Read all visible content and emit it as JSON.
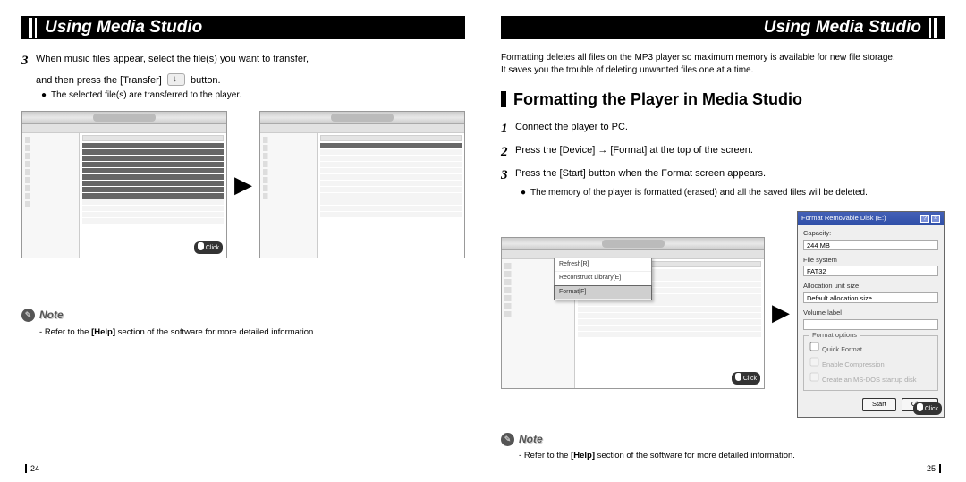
{
  "header": {
    "title": "Using Media Studio"
  },
  "left": {
    "step3": {
      "num": "3",
      "line1": "When music files appear, select the file(s) you want to transfer,",
      "line2_a": "and then press the [Transfer]",
      "line2_b": "button."
    },
    "bullet": "The selected file(s) are transferred to the player.",
    "click_label": "Click",
    "note": {
      "icon_glyph": "✎",
      "label": "Note",
      "text_a": "Refer to the ",
      "text_help": "[Help]",
      "text_b": " section of the software for more detailed information."
    },
    "page_number": "24"
  },
  "right": {
    "intro_line1": "Formatting deletes all files on the MP3 player so maximum memory is available for new file storage.",
    "intro_line2": "It saves you the trouble of deleting unwanted files one at a time.",
    "section_title": "Formatting the Player in Media Studio",
    "step1": {
      "num": "1",
      "text": "Connect the player to PC."
    },
    "step2": {
      "num": "2",
      "text": "Press the [Device] → [Format] at the top of the screen."
    },
    "step3": {
      "num": "3",
      "text": "Press the [Start] button when the Format screen appears."
    },
    "bullet": "The memory of the player is formatted (erased) and all the saved files will be deleted.",
    "context_menu": {
      "items": [
        "Refresh[R]",
        "Reconstruct Library[E]",
        "Format[F]"
      ],
      "highlighted": "Format[F]"
    },
    "dialog": {
      "title": "Format Removable Disk (E:)",
      "capacity_label": "Capacity:",
      "capacity_value": "244 MB",
      "filesystem_label": "File system",
      "filesystem_value": "FAT32",
      "alloc_label": "Allocation unit size",
      "alloc_value": "Default allocation size",
      "volume_label_lbl": "Volume label",
      "volume_label_val": "",
      "options_group": "Format options",
      "quick_format": "Quick Format",
      "enable_compression": "Enable Compression",
      "create_bootdisk": "Create an MS-DOS startup disk",
      "start_btn": "Start",
      "close_btn": "Close"
    },
    "click_label": "Click",
    "note": {
      "icon_glyph": "✎",
      "label": "Note",
      "text_a": "Refer to the ",
      "text_help": "[Help]",
      "text_b": " section of the software for more detailed information."
    },
    "page_number": "25"
  }
}
